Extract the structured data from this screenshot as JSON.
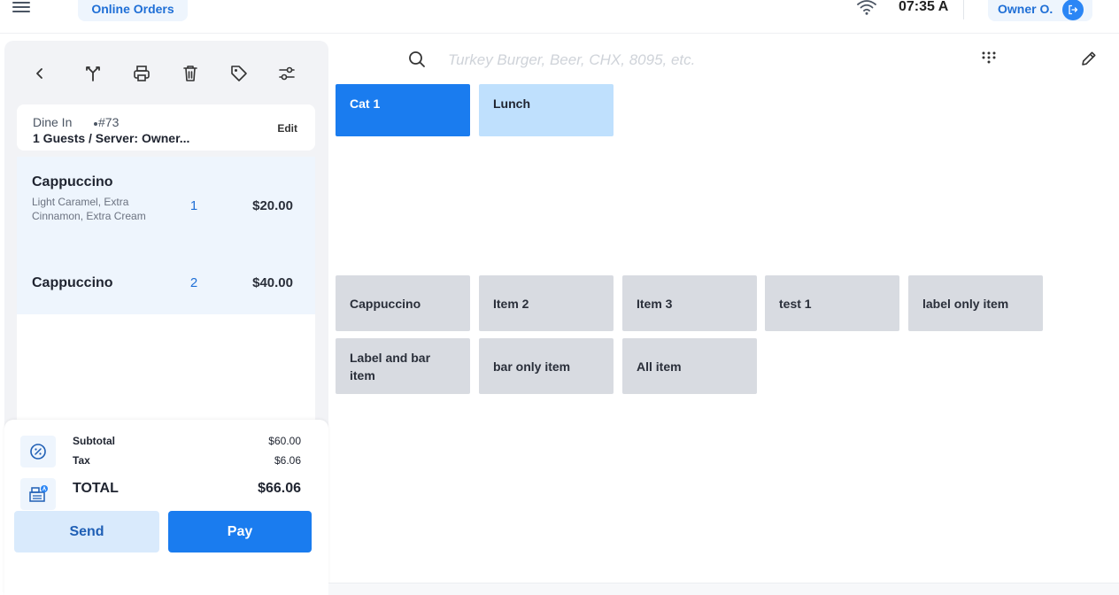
{
  "topbar": {
    "online_orders_label": "Online Orders",
    "time": "07:35 A",
    "user_name": "Owner O."
  },
  "order": {
    "type": "Dine In",
    "number": "#73",
    "guests_server": "1 Guests / Server: Owner...",
    "edit_label": "Edit",
    "items": [
      {
        "name": "Cappuccino",
        "modifiers": "Light Caramel, Extra Cinnamon, Extra Cream",
        "qty": "1",
        "price": "$20.00"
      },
      {
        "name": "Cappuccino",
        "modifiers": "",
        "qty": "2",
        "price": "$40.00"
      }
    ]
  },
  "totals": {
    "subtotal_label": "Subtotal",
    "subtotal_value": "$60.00",
    "tax_label": "Tax",
    "tax_value": "$6.06",
    "total_label": "TOTAL",
    "total_value": "$66.06"
  },
  "actions": {
    "send_label": "Send",
    "pay_label": "Pay"
  },
  "search": {
    "placeholder": "Turkey Burger, Beer, CHX, 8095, etc."
  },
  "categories": [
    {
      "label": "Cat 1",
      "active": true
    },
    {
      "label": "Lunch",
      "active": false
    }
  ],
  "menu_items": [
    "Cappuccino",
    "Item 2",
    "Item 3",
    "test 1",
    "label only item",
    "Label and bar item",
    "bar only item",
    "All item"
  ],
  "colors": {
    "accent": "#1a7cef",
    "accent_light": "#bfe0fd",
    "tile_gray": "#d8dbe1",
    "panel_bg": "#f2f3f6"
  },
  "icons": {
    "toolbar": [
      "back-icon",
      "split-icon",
      "print-icon",
      "trash-icon",
      "tag-icon",
      "adjust-icon"
    ],
    "totals": [
      "discount-icon",
      "cash-register-icon"
    ]
  }
}
